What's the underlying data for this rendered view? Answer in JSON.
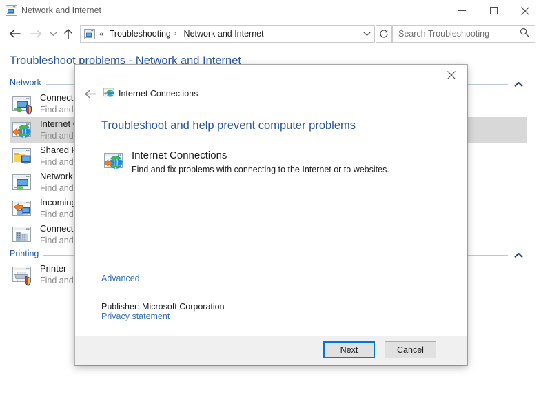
{
  "window": {
    "title": "Network and Internet",
    "icon": "network-window-icon",
    "minimize_label": "Minimize",
    "maximize_label": "Maximize",
    "close_label": "Close"
  },
  "navigation": {
    "back_label": "Back",
    "forward_label": "Forward",
    "recent_label": "Recent locations",
    "up_label": "Up",
    "refresh_label": "Refresh"
  },
  "address_bar": {
    "icon": "control-panel-icon",
    "overflow_glyph": "«",
    "separator": "›",
    "crumbs": [
      {
        "label": "Troubleshooting"
      },
      {
        "label": "Network and Internet"
      }
    ],
    "dropdown_label": "Previous locations"
  },
  "search": {
    "placeholder": "Search Troubleshooting",
    "value": "",
    "icon": "search-icon"
  },
  "page": {
    "title": "Troubleshoot problems - Network and Internet",
    "groups": [
      {
        "name": "Network",
        "collapse_icon": "chevron-up-icon",
        "items": [
          {
            "title": "Connecting",
            "subtitle": "Find and fi",
            "icon": "network-shield-icon",
            "selected": false
          },
          {
            "title": "Internet C",
            "subtitle": "Find and fi",
            "icon": "internet-globe-icon",
            "selected": true
          },
          {
            "title": "Shared Fol",
            "subtitle": "Find and fi",
            "icon": "shared-folder-icon",
            "selected": false
          },
          {
            "title": "Network A",
            "subtitle": "Find and fi",
            "icon": "network-adapter-icon",
            "selected": false
          },
          {
            "title": "Incoming",
            "subtitle": "Find and fi",
            "icon": "incoming-connections-icon",
            "selected": false
          },
          {
            "title": "Connectio",
            "subtitle": "Find and fi",
            "icon": "workplace-connection-icon",
            "selected": false
          }
        ]
      },
      {
        "name": "Printing",
        "collapse_icon": "chevron-up-icon",
        "items": [
          {
            "title": "Printer",
            "subtitle": "Find and fi",
            "icon": "printer-shield-icon",
            "selected": false
          }
        ]
      }
    ]
  },
  "dialog": {
    "header_title": "Internet Connections",
    "header_icon": "internet-globe-icon",
    "back_label": "Back",
    "close_label": "Close",
    "heading": "Troubleshoot and help prevent computer problems",
    "item": {
      "icon": "internet-globe-icon",
      "title": "Internet Connections",
      "description": "Find and fix problems with connecting to the Internet or to websites."
    },
    "advanced_link": "Advanced",
    "publisher": "Publisher:  Microsoft Corporation",
    "privacy_link": "Privacy statement",
    "buttons": {
      "next": "Next",
      "cancel": "Cancel"
    }
  },
  "colors": {
    "accent_blue": "#2a5699",
    "link_blue": "#3570b8",
    "group_blue": "#1e5aa8",
    "focus_blue": "#0078d7",
    "selection_gray": "#d8d8d8",
    "footer_gray": "#f0f0f0"
  }
}
